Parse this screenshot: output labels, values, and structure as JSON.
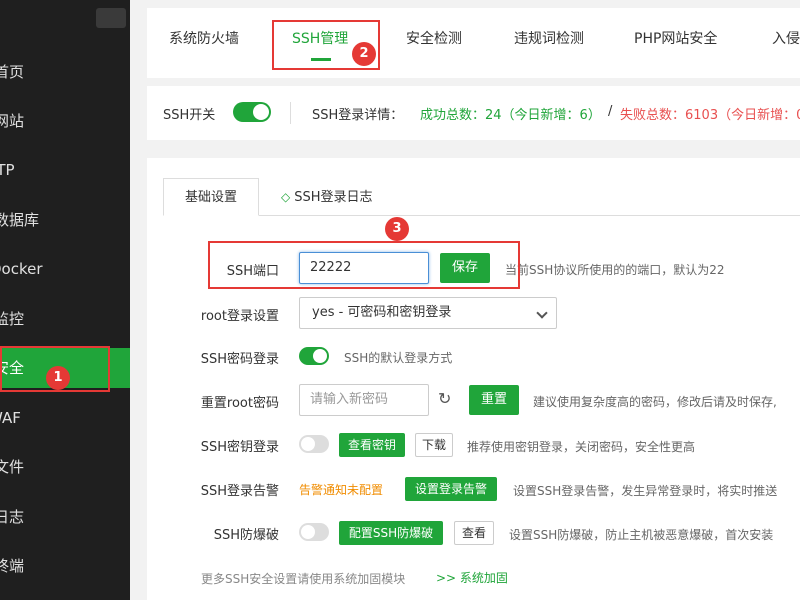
{
  "sidebar": {
    "items": [
      {
        "label": "首页"
      },
      {
        "label": "网站"
      },
      {
        "label": "FTP"
      },
      {
        "label": "数据库"
      },
      {
        "label": "Docker"
      },
      {
        "label": "监控"
      },
      {
        "label": "安全"
      },
      {
        "label": "WAF"
      },
      {
        "label": "文件"
      },
      {
        "label": "日志"
      },
      {
        "label": "终端"
      }
    ]
  },
  "tabs": [
    {
      "label": "系统防火墙"
    },
    {
      "label": "SSH管理"
    },
    {
      "label": "安全检测"
    },
    {
      "label": "违规词检测"
    },
    {
      "label": "PHP网站安全"
    },
    {
      "label": "入侵"
    }
  ],
  "status": {
    "ssh_switch_label": "SSH开关",
    "ssh_login_details_label": "SSH登录详情：",
    "success_text": "成功总数：24（今日新增：6）",
    "divider": "/",
    "fail_text": "失败总数：6103（今日新增：0"
  },
  "panel": {
    "tab_basic": "基础设置",
    "tab_log": "SSH登录日志",
    "port": {
      "label": "SSH端口",
      "value": "22222",
      "save": "保存",
      "hint": "当前SSH协议所使用的的端口，默认为22"
    },
    "root_login": {
      "label": "root登录设置",
      "selected": "yes - 可密码和密钥登录"
    },
    "password_login": {
      "label": "SSH密码登录",
      "hint": "SSH的默认登录方式"
    },
    "reset_root": {
      "label": "重置root密码",
      "placeholder": "请输入新密码",
      "button": "重置",
      "hint": "建议使用复杂度高的密码，修改后请及时保存,"
    },
    "key_login": {
      "label": "SSH密钥登录",
      "view": "查看密钥",
      "download": "下载",
      "hint": "推荐使用密钥登录，关闭密码，安全性更高"
    },
    "alert": {
      "label": "SSH登录告警",
      "status": "告警通知未配置",
      "button": "设置登录告警",
      "hint": "设置SSH登录告警，发生异常登录时，将实时推送"
    },
    "brute": {
      "label": "SSH防爆破",
      "button": "配置SSH防爆破",
      "view": "查看",
      "hint": "设置SSH防爆破，防止主机被恶意爆破，首次安装"
    },
    "footer": {
      "text": "更多SSH安全设置请使用系统加固模块",
      "link": ">> 系统加固"
    }
  },
  "annotations": {
    "badge1": "1",
    "badge2": "2",
    "badge3": "3"
  },
  "colors": {
    "accent": "#20a53a",
    "annotation": "#e53935",
    "sidebar_bg": "#1f1f1f"
  }
}
